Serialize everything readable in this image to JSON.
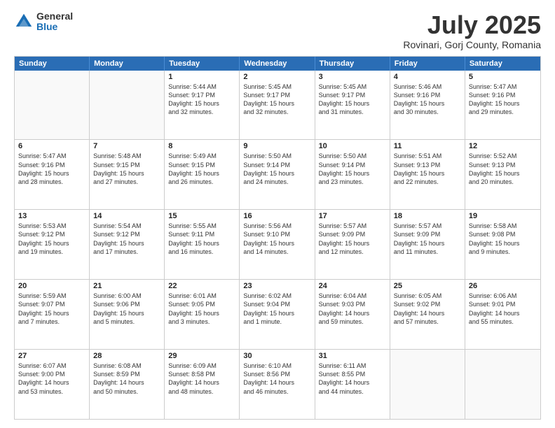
{
  "logo": {
    "general": "General",
    "blue": "Blue"
  },
  "title": "July 2025",
  "location": "Rovinari, Gorj County, Romania",
  "weekdays": [
    "Sunday",
    "Monday",
    "Tuesday",
    "Wednesday",
    "Thursday",
    "Friday",
    "Saturday"
  ],
  "rows": [
    [
      {
        "day": "",
        "lines": [],
        "empty": true
      },
      {
        "day": "",
        "lines": [],
        "empty": true
      },
      {
        "day": "1",
        "lines": [
          "Sunrise: 5:44 AM",
          "Sunset: 9:17 PM",
          "Daylight: 15 hours",
          "and 32 minutes."
        ]
      },
      {
        "day": "2",
        "lines": [
          "Sunrise: 5:45 AM",
          "Sunset: 9:17 PM",
          "Daylight: 15 hours",
          "and 32 minutes."
        ]
      },
      {
        "day": "3",
        "lines": [
          "Sunrise: 5:45 AM",
          "Sunset: 9:17 PM",
          "Daylight: 15 hours",
          "and 31 minutes."
        ]
      },
      {
        "day": "4",
        "lines": [
          "Sunrise: 5:46 AM",
          "Sunset: 9:16 PM",
          "Daylight: 15 hours",
          "and 30 minutes."
        ]
      },
      {
        "day": "5",
        "lines": [
          "Sunrise: 5:47 AM",
          "Sunset: 9:16 PM",
          "Daylight: 15 hours",
          "and 29 minutes."
        ]
      }
    ],
    [
      {
        "day": "6",
        "lines": [
          "Sunrise: 5:47 AM",
          "Sunset: 9:16 PM",
          "Daylight: 15 hours",
          "and 28 minutes."
        ]
      },
      {
        "day": "7",
        "lines": [
          "Sunrise: 5:48 AM",
          "Sunset: 9:15 PM",
          "Daylight: 15 hours",
          "and 27 minutes."
        ]
      },
      {
        "day": "8",
        "lines": [
          "Sunrise: 5:49 AM",
          "Sunset: 9:15 PM",
          "Daylight: 15 hours",
          "and 26 minutes."
        ]
      },
      {
        "day": "9",
        "lines": [
          "Sunrise: 5:50 AM",
          "Sunset: 9:14 PM",
          "Daylight: 15 hours",
          "and 24 minutes."
        ]
      },
      {
        "day": "10",
        "lines": [
          "Sunrise: 5:50 AM",
          "Sunset: 9:14 PM",
          "Daylight: 15 hours",
          "and 23 minutes."
        ]
      },
      {
        "day": "11",
        "lines": [
          "Sunrise: 5:51 AM",
          "Sunset: 9:13 PM",
          "Daylight: 15 hours",
          "and 22 minutes."
        ]
      },
      {
        "day": "12",
        "lines": [
          "Sunrise: 5:52 AM",
          "Sunset: 9:13 PM",
          "Daylight: 15 hours",
          "and 20 minutes."
        ]
      }
    ],
    [
      {
        "day": "13",
        "lines": [
          "Sunrise: 5:53 AM",
          "Sunset: 9:12 PM",
          "Daylight: 15 hours",
          "and 19 minutes."
        ]
      },
      {
        "day": "14",
        "lines": [
          "Sunrise: 5:54 AM",
          "Sunset: 9:12 PM",
          "Daylight: 15 hours",
          "and 17 minutes."
        ]
      },
      {
        "day": "15",
        "lines": [
          "Sunrise: 5:55 AM",
          "Sunset: 9:11 PM",
          "Daylight: 15 hours",
          "and 16 minutes."
        ]
      },
      {
        "day": "16",
        "lines": [
          "Sunrise: 5:56 AM",
          "Sunset: 9:10 PM",
          "Daylight: 15 hours",
          "and 14 minutes."
        ]
      },
      {
        "day": "17",
        "lines": [
          "Sunrise: 5:57 AM",
          "Sunset: 9:09 PM",
          "Daylight: 15 hours",
          "and 12 minutes."
        ]
      },
      {
        "day": "18",
        "lines": [
          "Sunrise: 5:57 AM",
          "Sunset: 9:09 PM",
          "Daylight: 15 hours",
          "and 11 minutes."
        ]
      },
      {
        "day": "19",
        "lines": [
          "Sunrise: 5:58 AM",
          "Sunset: 9:08 PM",
          "Daylight: 15 hours",
          "and 9 minutes."
        ]
      }
    ],
    [
      {
        "day": "20",
        "lines": [
          "Sunrise: 5:59 AM",
          "Sunset: 9:07 PM",
          "Daylight: 15 hours",
          "and 7 minutes."
        ]
      },
      {
        "day": "21",
        "lines": [
          "Sunrise: 6:00 AM",
          "Sunset: 9:06 PM",
          "Daylight: 15 hours",
          "and 5 minutes."
        ]
      },
      {
        "day": "22",
        "lines": [
          "Sunrise: 6:01 AM",
          "Sunset: 9:05 PM",
          "Daylight: 15 hours",
          "and 3 minutes."
        ]
      },
      {
        "day": "23",
        "lines": [
          "Sunrise: 6:02 AM",
          "Sunset: 9:04 PM",
          "Daylight: 15 hours",
          "and 1 minute."
        ]
      },
      {
        "day": "24",
        "lines": [
          "Sunrise: 6:04 AM",
          "Sunset: 9:03 PM",
          "Daylight: 14 hours",
          "and 59 minutes."
        ]
      },
      {
        "day": "25",
        "lines": [
          "Sunrise: 6:05 AM",
          "Sunset: 9:02 PM",
          "Daylight: 14 hours",
          "and 57 minutes."
        ]
      },
      {
        "day": "26",
        "lines": [
          "Sunrise: 6:06 AM",
          "Sunset: 9:01 PM",
          "Daylight: 14 hours",
          "and 55 minutes."
        ]
      }
    ],
    [
      {
        "day": "27",
        "lines": [
          "Sunrise: 6:07 AM",
          "Sunset: 9:00 PM",
          "Daylight: 14 hours",
          "and 53 minutes."
        ]
      },
      {
        "day": "28",
        "lines": [
          "Sunrise: 6:08 AM",
          "Sunset: 8:59 PM",
          "Daylight: 14 hours",
          "and 50 minutes."
        ]
      },
      {
        "day": "29",
        "lines": [
          "Sunrise: 6:09 AM",
          "Sunset: 8:58 PM",
          "Daylight: 14 hours",
          "and 48 minutes."
        ]
      },
      {
        "day": "30",
        "lines": [
          "Sunrise: 6:10 AM",
          "Sunset: 8:56 PM",
          "Daylight: 14 hours",
          "and 46 minutes."
        ]
      },
      {
        "day": "31",
        "lines": [
          "Sunrise: 6:11 AM",
          "Sunset: 8:55 PM",
          "Daylight: 14 hours",
          "and 44 minutes."
        ]
      },
      {
        "day": "",
        "lines": [],
        "empty": true
      },
      {
        "day": "",
        "lines": [],
        "empty": true
      }
    ]
  ]
}
